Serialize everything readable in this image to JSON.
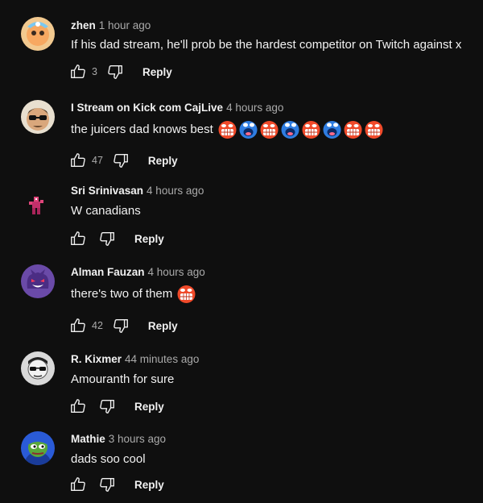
{
  "comments": [
    {
      "author": "zhen",
      "time": "1 hour ago",
      "text": "If his dad stream, he'll prob be the hardest competitor on Twitch against x",
      "likes": "3",
      "reply": "Reply",
      "avatar": "avatar-cartoon-icon"
    },
    {
      "author": "I Stream on Kick com CajLive",
      "time": "4 hours ago",
      "text": "the juicers dad knows best",
      "likes": "47",
      "reply": "Reply",
      "avatar": "avatar-sunglasses-man-icon",
      "emotes": [
        "screaming-red-emote-icon",
        "screaming-blue-emote-icon",
        "screaming-red-emote-icon",
        "screaming-blue-emote-icon",
        "screaming-red-emote-icon",
        "screaming-blue-emote-icon",
        "screaming-red-emote-icon",
        "screaming-red-emote-icon"
      ]
    },
    {
      "author": "Sri Srinivasan",
      "time": "4 hours ago",
      "text": "W canadians",
      "likes": "",
      "reply": "Reply",
      "avatar": "avatar-pixel-character-icon"
    },
    {
      "author": "Alman Fauzan",
      "time": "4 hours ago",
      "text": "there's two of them",
      "likes": "42",
      "reply": "Reply",
      "avatar": "avatar-gengar-icon",
      "emotes": [
        "screaming-red-emote-icon"
      ]
    },
    {
      "author": "R. Kixmer",
      "time": "44 minutes ago",
      "text": "Amouranth for sure",
      "likes": "",
      "reply": "Reply",
      "avatar": "avatar-bw-sunglasses-icon"
    },
    {
      "author": "Mathie",
      "time": "3 hours ago",
      "text": "dads soo cool",
      "likes": "",
      "reply": "Reply",
      "avatar": "avatar-pepe-icon"
    }
  ],
  "colors": {
    "background": "#0f0f0f",
    "text": "#f1f1f1",
    "secondary": "#aaaaaa"
  }
}
